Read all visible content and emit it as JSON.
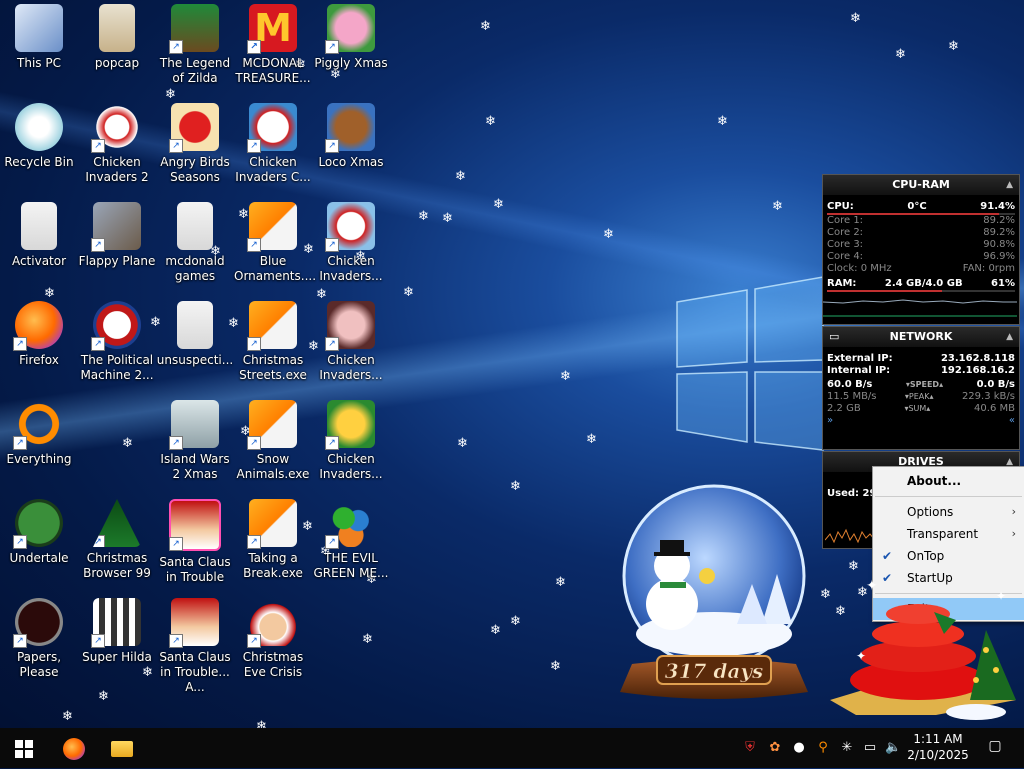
{
  "desktop": {
    "icons": [
      {
        "label": "This PC"
      },
      {
        "label": "popcap"
      },
      {
        "label": "The Legend of Zilda"
      },
      {
        "label": "MCDONAL TREASURE..."
      },
      {
        "label": "Piggly Xmas"
      },
      {
        "label": "Recycle Bin"
      },
      {
        "label": "Chicken Invaders 2"
      },
      {
        "label": "Angry Birds Seasons"
      },
      {
        "label": "Chicken Invaders C..."
      },
      {
        "label": "Loco Xmas"
      },
      {
        "label": "Activator"
      },
      {
        "label": "Flappy Plane"
      },
      {
        "label": "mcdonald games"
      },
      {
        "label": "Blue Ornaments...."
      },
      {
        "label": "Chicken Invaders..."
      },
      {
        "label": "Firefox"
      },
      {
        "label": "The Political Machine 2..."
      },
      {
        "label": "unsuspecti..."
      },
      {
        "label": "Christmas Streets.exe"
      },
      {
        "label": "Chicken Invaders..."
      },
      {
        "label": "Everything"
      },
      {
        "label": "Island Wars 2 Xmas"
      },
      {
        "label": "Snow Animals.exe"
      },
      {
        "label": "Chicken Invaders..."
      },
      {
        "label": "Undertale"
      },
      {
        "label": "Christmas Browser 99"
      },
      {
        "label": "Santa Claus in Trouble"
      },
      {
        "label": "Taking a Break.exe"
      },
      {
        "label": "THE EVIL GREEN ME..."
      },
      {
        "label": "Papers, Please"
      },
      {
        "label": "Super Hilda"
      },
      {
        "label": "Santa Claus in Trouble... A..."
      },
      {
        "label": "Christmas Eve Crisis"
      }
    ]
  },
  "cpu_ram": {
    "title": "CPU-RAM",
    "cpu_label": "CPU:",
    "cpu_temp": "0°C",
    "cpu_pct": "91.4%",
    "cpu_value": 91.4,
    "cores": [
      {
        "label": "Core 1:",
        "value": "89.2%",
        "pct": 89.2
      },
      {
        "label": "Core 2:",
        "value": "89.2%",
        "pct": 89.2
      },
      {
        "label": "Core 3:",
        "value": "90.8%",
        "pct": 90.8
      },
      {
        "label": "Core 4:",
        "value": "96.9%",
        "pct": 96.9
      }
    ],
    "clock_label": "Clock: 0 MHz",
    "fan_label": "FAN: 0rpm",
    "ram_label": "RAM:",
    "ram_value": "2.4 GB/4.0 GB",
    "ram_pct": "61%",
    "ram_fill": 61
  },
  "network": {
    "title": "NETWORK",
    "external_label": "External IP:",
    "external_ip": "23.162.8.118",
    "internal_label": "Internal IP:",
    "internal_ip": "192.168.16.2",
    "speed_down": "60.0 B/s",
    "speed_label": "SPEED",
    "speed_up": "0.0 B/s",
    "peak_down": "11.5 MB/s",
    "peak_label": "PEAK",
    "peak_up": "229.3 kB/s",
    "sum_down": "2.2 GB",
    "sum_label": "SUM",
    "sum_up": "40.6 MB"
  },
  "drives": {
    "title": "DRIVES",
    "used_label": "Used: 29"
  },
  "context_menu": {
    "items": [
      {
        "label": "About...",
        "bold": true
      },
      {
        "label": "Options"
      },
      {
        "label": "Transparent"
      },
      {
        "label": "OnTop",
        "checked": true
      },
      {
        "label": "StartUp",
        "checked": true
      },
      {
        "label": "Exit",
        "highlighted": true
      }
    ]
  },
  "snow_globe": {
    "countdown": "317 days"
  },
  "taskbar": {
    "time": "1:11 AM",
    "date": "2/10/2025"
  },
  "colors": {
    "menu_highlight": "#91c9f7",
    "accent": "#1a55b0"
  }
}
